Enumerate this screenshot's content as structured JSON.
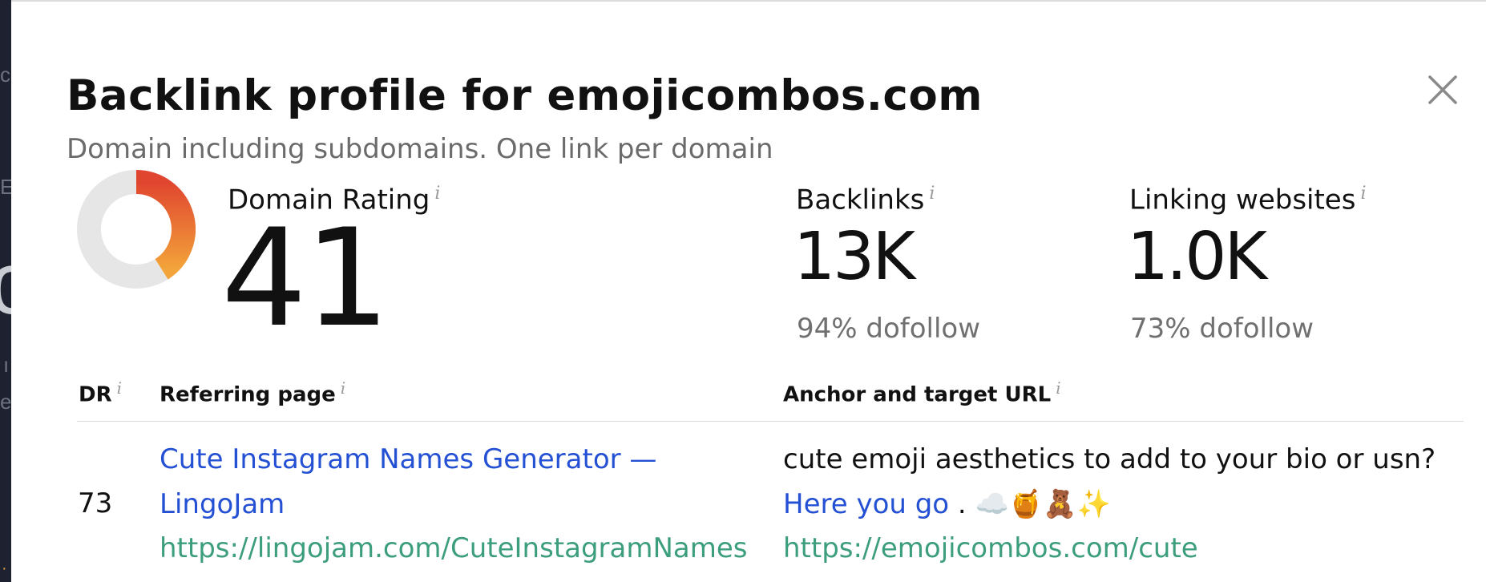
{
  "modal": {
    "title": "Backlink profile for emojicombos.com",
    "subtitle": "Domain including subdomains. One link per domain",
    "close_icon": "close-icon"
  },
  "metrics": {
    "domain_rating": {
      "label": "Domain Rating",
      "value": "41",
      "gauge_fraction": 0.41,
      "gauge_colors": [
        "#e0452f",
        "#f3a43a"
      ],
      "gauge_track": "#e6e6e6"
    },
    "backlinks": {
      "label": "Backlinks",
      "value": "13K",
      "sub": "94% dofollow"
    },
    "linking_websites": {
      "label": "Linking websites",
      "value": "1.0K",
      "sub": "73% dofollow"
    },
    "info_glyph": "i"
  },
  "table": {
    "headers": {
      "dr": "DR",
      "referring_page": "Referring page",
      "anchor": "Anchor and target URL"
    },
    "rows": [
      {
        "dr": "73",
        "referring_title": "Cute Instagram Names Generator — LingoJam",
        "referring_url": "https://lingojam.com/CuteInstagramNames",
        "anchor_prefix": "cute emoji aesthetics to add to your bio or usn?",
        "anchor_link": "Here you go",
        "anchor_suffix": " . ☁️🍯🧸✨",
        "target_url": "https://emojicombos.com/cute"
      }
    ]
  },
  "colors": {
    "link_blue": "#2450d4",
    "url_green": "#3c9e7d",
    "muted_gray": "#707070"
  }
}
